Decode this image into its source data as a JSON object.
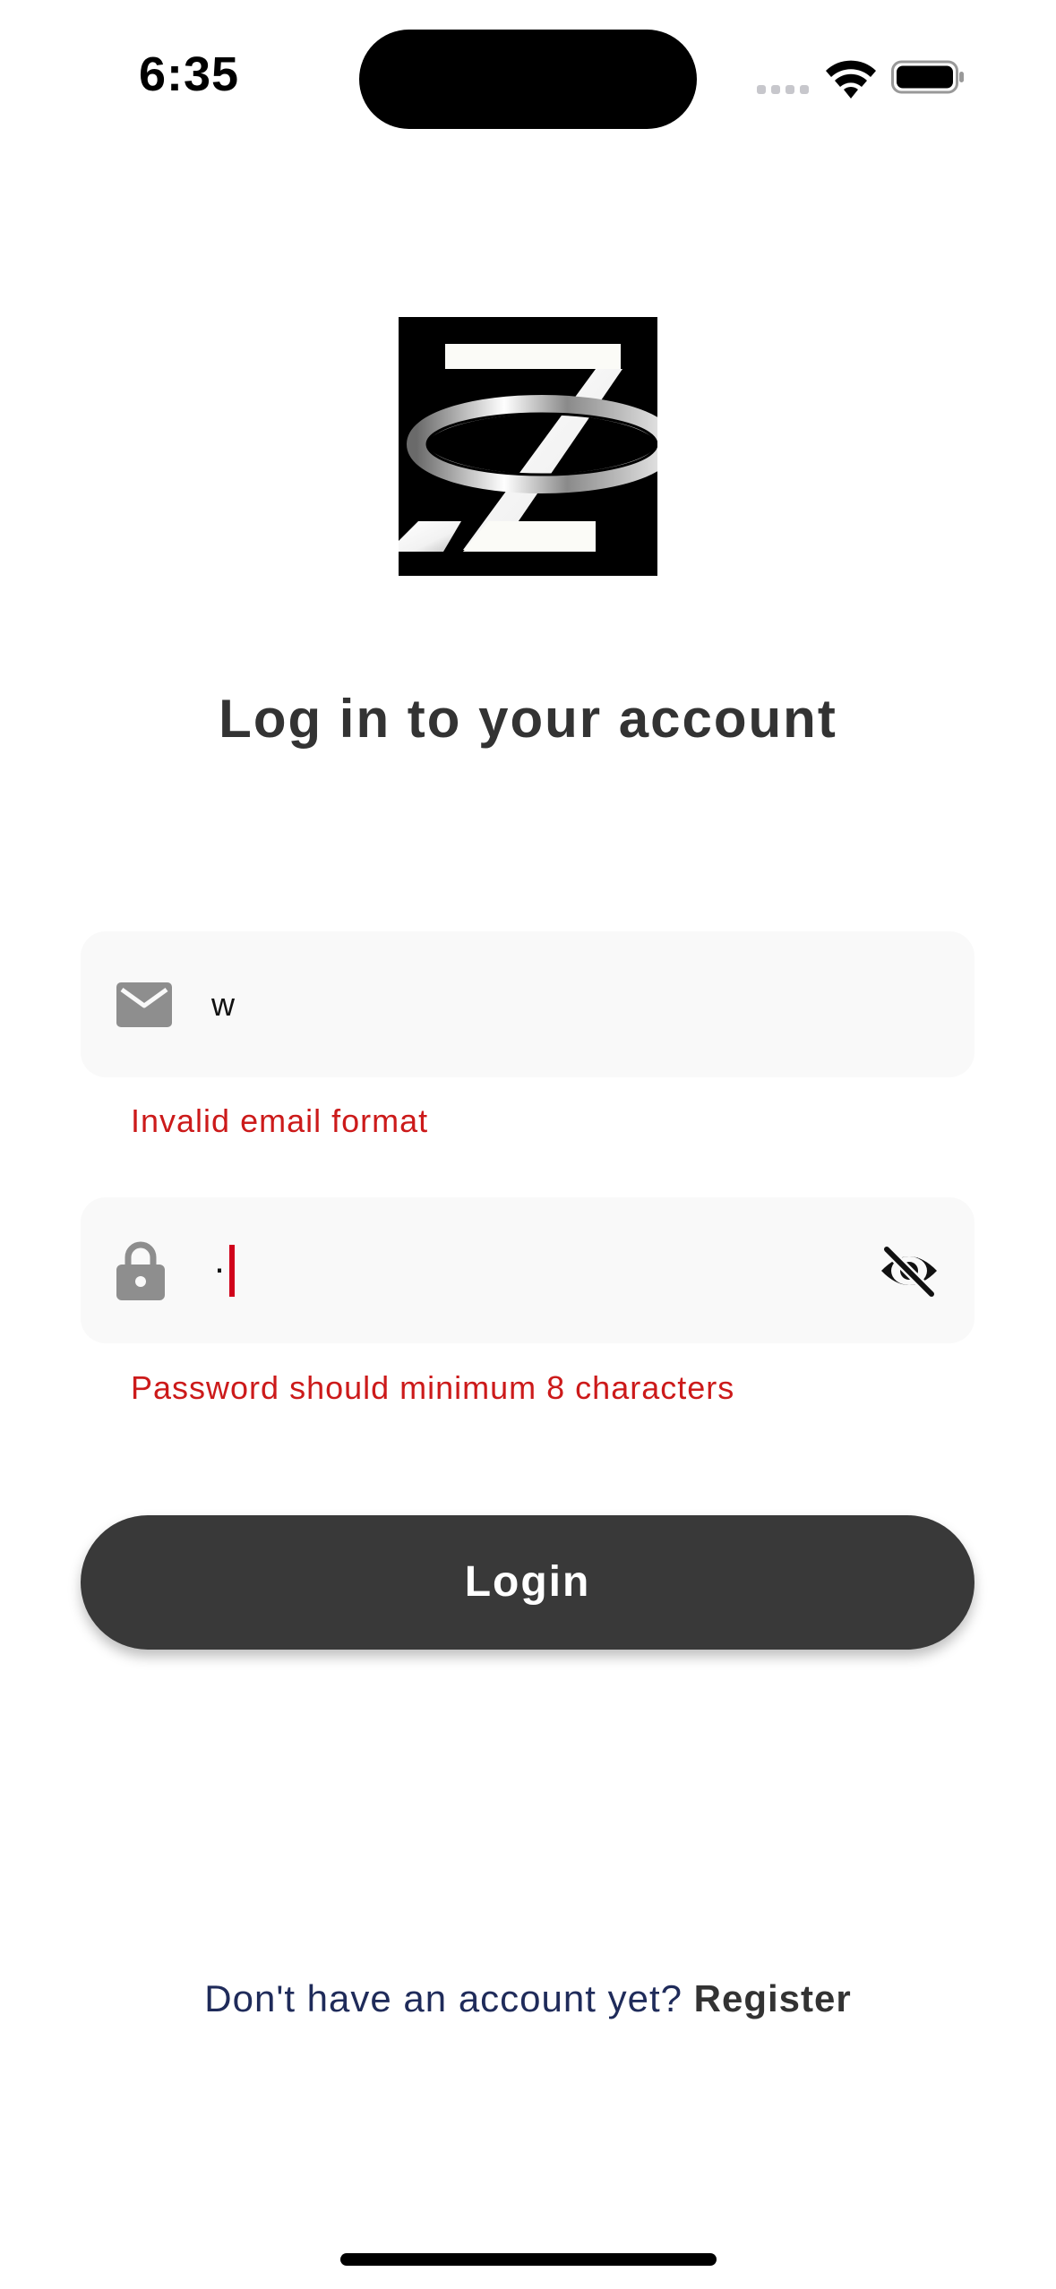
{
  "status_bar": {
    "time": "6:35"
  },
  "login": {
    "title": "Log in to your account",
    "email": {
      "value": "w",
      "error": "Invalid email format",
      "icon": "mail-icon"
    },
    "password": {
      "value": "·",
      "error": "Password should minimum 8 characters",
      "icon": "lock-icon",
      "toggle_icon": "eye-slash-icon"
    },
    "button_label": "Login",
    "register_prompt": "Don't have an account yet?",
    "register_link": "Register"
  },
  "colors": {
    "error": "#cc1a1a",
    "button": "#393939",
    "field_bg": "#f9f9f9",
    "caret": "#d0021b"
  }
}
